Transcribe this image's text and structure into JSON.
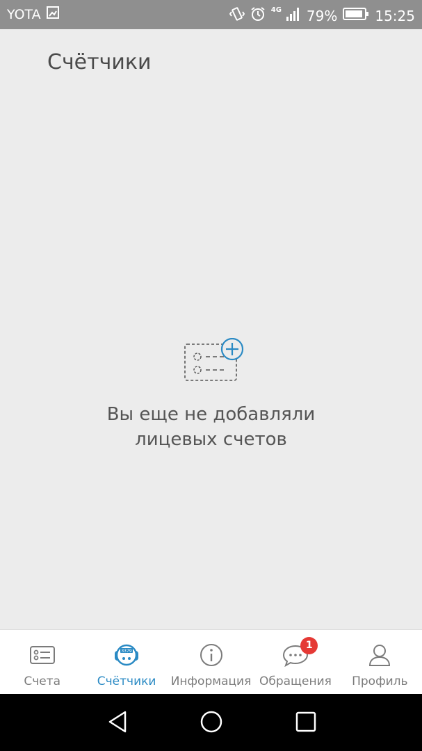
{
  "status_bar": {
    "carrier": "YOTA",
    "network_type": "4G",
    "battery": "79%",
    "time": "15:25",
    "icons": [
      "image-icon",
      "vibrate-icon",
      "alarm-icon",
      "signal-icon",
      "battery-icon"
    ]
  },
  "header": {
    "title": "Счётчики"
  },
  "empty_state": {
    "icon": "add-account-icon",
    "message_line1": "Вы еще не добавляли",
    "message_line2": "лицевых счетов"
  },
  "bottom_nav": {
    "tabs": [
      {
        "label": "Счета",
        "icon": "account-list-icon",
        "active": false
      },
      {
        "label": "Счётчики",
        "icon": "meter-icon",
        "active": true
      },
      {
        "label": "Информация",
        "icon": "info-icon",
        "active": false
      },
      {
        "label": "Обращения",
        "icon": "chat-icon",
        "active": false,
        "badge": "1"
      },
      {
        "label": "Профиль",
        "icon": "profile-icon",
        "active": false
      }
    ]
  },
  "colors": {
    "accent": "#2a8ac4",
    "badge": "#e53935",
    "background": "#ececec"
  },
  "android_nav": {
    "buttons": [
      "back",
      "home",
      "recents"
    ]
  }
}
